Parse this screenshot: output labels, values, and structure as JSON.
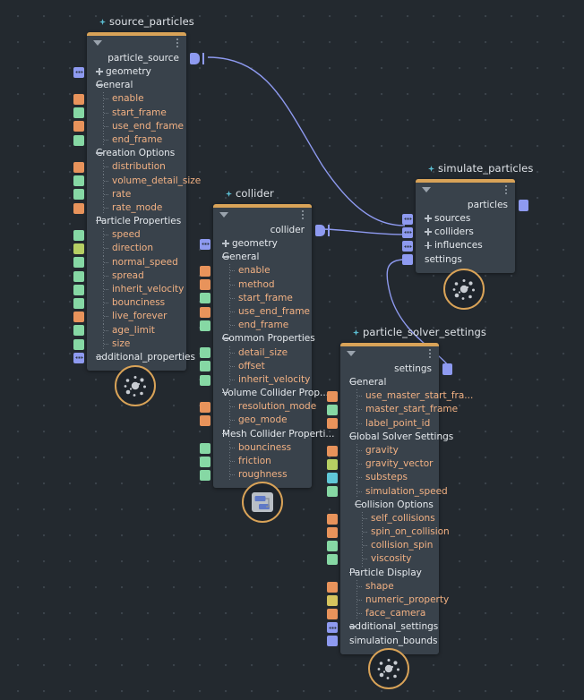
{
  "app": {
    "type": "node-graph-editor",
    "background_color": "#23292f",
    "node_color": "#39424b",
    "accent_color": "#d9a358",
    "wire_color": "#8e9af0"
  },
  "nodes": [
    {
      "id": "source_particles",
      "title": "source_particles",
      "output_label": "particle_source",
      "badge_icon": "particles-icon",
      "rows": [
        {
          "label": "geometry",
          "kind": "plus",
          "port": "multi"
        },
        {
          "label": "General",
          "kind": "group",
          "port": null
        },
        {
          "label": "enable",
          "kind": "leaf",
          "port": "orange"
        },
        {
          "label": "start_frame",
          "kind": "leaf",
          "port": "green"
        },
        {
          "label": "use_end_frame",
          "kind": "leaf",
          "port": "orange"
        },
        {
          "label": "end_frame",
          "kind": "leaf",
          "port": "green"
        },
        {
          "label": "Creation Options",
          "kind": "group",
          "port": null
        },
        {
          "label": "distribution",
          "kind": "leaf",
          "port": "orange"
        },
        {
          "label": "volume_detail_size",
          "kind": "leaf",
          "port": "green"
        },
        {
          "label": "rate",
          "kind": "leaf",
          "port": "green"
        },
        {
          "label": "rate_mode",
          "kind": "leaf",
          "port": "orange"
        },
        {
          "label": "Particle Properties",
          "kind": "group",
          "port": null
        },
        {
          "label": "speed",
          "kind": "leaf",
          "port": "green"
        },
        {
          "label": "direction",
          "kind": "leaf",
          "port": "lime"
        },
        {
          "label": "normal_speed",
          "kind": "leaf",
          "port": "green"
        },
        {
          "label": "spread",
          "kind": "leaf",
          "port": "green"
        },
        {
          "label": "inherit_velocity",
          "kind": "leaf",
          "port": "green"
        },
        {
          "label": "bounciness",
          "kind": "leaf",
          "port": "green"
        },
        {
          "label": "live_forever",
          "kind": "leaf",
          "port": "orange"
        },
        {
          "label": "age_limit",
          "kind": "leaf",
          "port": "green"
        },
        {
          "label": "size",
          "kind": "leaf",
          "port": "green"
        },
        {
          "label": "additional_properties",
          "kind": "group",
          "port": "multi"
        }
      ]
    },
    {
      "id": "collider",
      "title": "collider",
      "output_label": "collider",
      "badge_icon": "nodes-icon",
      "rows": [
        {
          "label": "geometry",
          "kind": "plus",
          "port": "multi"
        },
        {
          "label": "General",
          "kind": "group",
          "port": null
        },
        {
          "label": "enable",
          "kind": "leaf",
          "port": "orange"
        },
        {
          "label": "method",
          "kind": "leaf",
          "port": "orange"
        },
        {
          "label": "start_frame",
          "kind": "leaf",
          "port": "green"
        },
        {
          "label": "use_end_frame",
          "kind": "leaf",
          "port": "orange"
        },
        {
          "label": "end_frame",
          "kind": "leaf",
          "port": "green"
        },
        {
          "label": "Common Properties",
          "kind": "group",
          "port": null
        },
        {
          "label": "detail_size",
          "kind": "leaf",
          "port": "green"
        },
        {
          "label": "offset",
          "kind": "leaf",
          "port": "green"
        },
        {
          "label": "inherit_velocity",
          "kind": "leaf",
          "port": "green"
        },
        {
          "label": "Volume Collider Prop...",
          "kind": "group",
          "port": null
        },
        {
          "label": "resolution_mode",
          "kind": "leaf",
          "port": "orange"
        },
        {
          "label": "geo_mode",
          "kind": "leaf",
          "port": "orange"
        },
        {
          "label": "Mesh Collider Properti...",
          "kind": "group",
          "port": null
        },
        {
          "label": "bounciness",
          "kind": "leaf",
          "port": "green"
        },
        {
          "label": "friction",
          "kind": "leaf",
          "port": "green"
        },
        {
          "label": "roughness",
          "kind": "leaf",
          "port": "green"
        }
      ]
    },
    {
      "id": "simulate_particles",
      "title": "simulate_particles",
      "output_label": "particles",
      "badge_icon": "particles-icon",
      "rows": [
        {
          "label": "sources",
          "kind": "plus",
          "port": "multi"
        },
        {
          "label": "colliders",
          "kind": "plus",
          "port": "multi"
        },
        {
          "label": "influences",
          "kind": "plus",
          "port": "multi"
        },
        {
          "label": "settings",
          "kind": "plain",
          "port": "blue"
        }
      ]
    },
    {
      "id": "particle_solver_settings",
      "title": "particle_solver_settings",
      "output_label": "settings",
      "badge_icon": "particles-icon",
      "rows": [
        {
          "label": "General",
          "kind": "group",
          "port": null
        },
        {
          "label": "use_master_start_fra...",
          "kind": "leaf",
          "port": "orange"
        },
        {
          "label": "master_start_frame",
          "kind": "leaf",
          "port": "green"
        },
        {
          "label": "label_point_id",
          "kind": "leaf",
          "port": "orange"
        },
        {
          "label": "Global Solver Settings",
          "kind": "group",
          "port": null
        },
        {
          "label": "gravity",
          "kind": "leaf",
          "port": "orange"
        },
        {
          "label": "gravity_vector",
          "kind": "leaf",
          "port": "lime"
        },
        {
          "label": "substeps",
          "kind": "leaf",
          "port": "cyan"
        },
        {
          "label": "simulation_speed",
          "kind": "leaf",
          "port": "green"
        },
        {
          "label": "Collision Options",
          "kind": "grp2",
          "port": null
        },
        {
          "label": "self_collisions",
          "kind": "leaf2",
          "port": "orange"
        },
        {
          "label": "spin_on_collision",
          "kind": "leaf2",
          "port": "orange"
        },
        {
          "label": "collision_spin",
          "kind": "leaf2",
          "port": "green"
        },
        {
          "label": "viscosity",
          "kind": "leaf2",
          "port": "green"
        },
        {
          "label": "Particle Display",
          "kind": "group",
          "port": null
        },
        {
          "label": "shape",
          "kind": "leaf",
          "port": "orange"
        },
        {
          "label": "numeric_property",
          "kind": "leaf",
          "port": "yellow"
        },
        {
          "label": "face_camera",
          "kind": "leaf",
          "port": "orange"
        },
        {
          "label": "additional_settings",
          "kind": "group",
          "port": "multi"
        },
        {
          "label": "simulation_bounds",
          "kind": "plain",
          "port": "blue"
        }
      ]
    }
  ],
  "connections": [
    {
      "from": "source_particles.particle_source",
      "to": "simulate_particles.sources"
    },
    {
      "from": "collider.collider",
      "to": "simulate_particles.colliders"
    },
    {
      "from": "particle_solver_settings.settings",
      "to": "simulate_particles.settings"
    }
  ]
}
